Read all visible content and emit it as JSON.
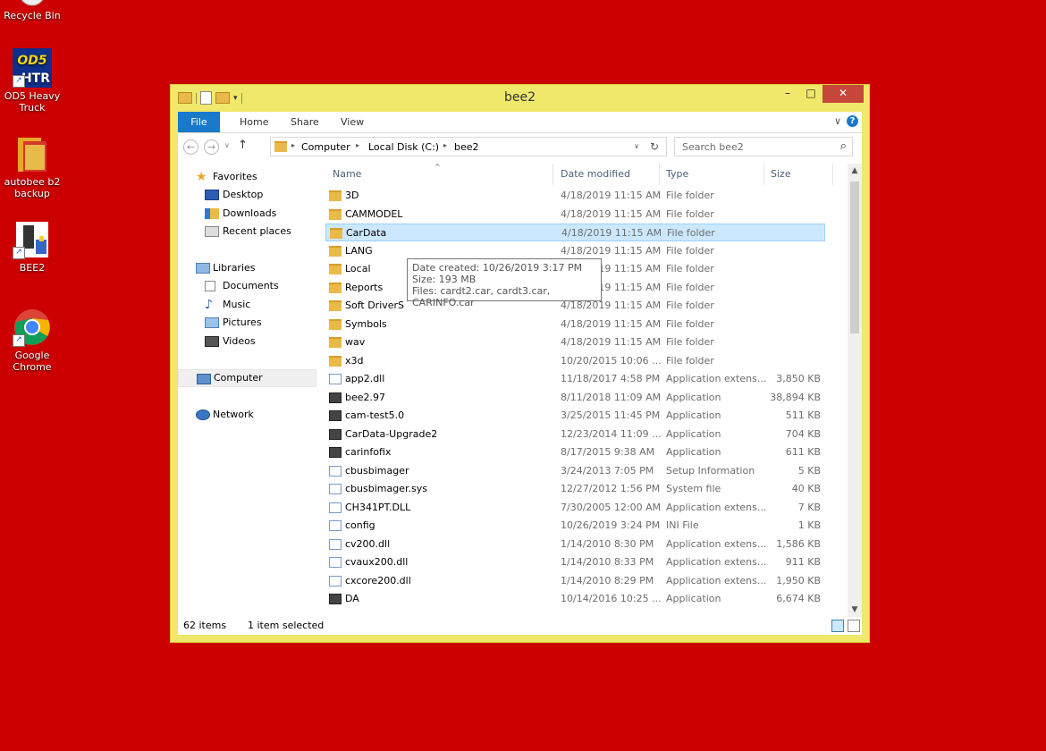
{
  "desktop": {
    "icons": [
      {
        "label": "Recycle Bin"
      },
      {
        "label": "OD5 Heavy Truck",
        "badge_top": "OD5",
        "badge_bottom": "HTR"
      },
      {
        "label": "autobee b2 backup"
      },
      {
        "label": "BEE2"
      },
      {
        "label": "Google Chrome"
      }
    ]
  },
  "window": {
    "title": "bee2",
    "controls": {
      "minimize": "–",
      "maximize": "□",
      "close": "✕"
    },
    "ribbon": {
      "tabs": [
        "File",
        "Home",
        "Share",
        "View"
      ],
      "expand_glyph": "∨",
      "help_glyph": "?"
    },
    "address": {
      "back_glyph": "←",
      "forward_glyph": "→",
      "recent_glyph": "∨",
      "up_glyph": "↑",
      "crumbs": [
        "Computer",
        "Local Disk (C:)",
        "bee2"
      ],
      "crumb_sep": "▸",
      "dropdown_glyph": "∨",
      "refresh_glyph": "↻"
    },
    "search": {
      "placeholder": "Search bee2",
      "icon_glyph": "⌕"
    },
    "nav": {
      "favorites": "Favorites",
      "favorites_items": [
        "Desktop",
        "Downloads",
        "Recent places"
      ],
      "libraries": "Libraries",
      "libraries_items": [
        "Documents",
        "Music",
        "Pictures",
        "Videos"
      ],
      "computer": "Computer",
      "network": "Network"
    },
    "columns": {
      "name": "Name",
      "date": "Date modified",
      "type": "Type",
      "size": "Size",
      "sort_glyph": "^"
    },
    "files": [
      {
        "name": "3D",
        "date": "4/18/2019 11:15 AM",
        "type": "File folder",
        "size": "",
        "kind": "folder"
      },
      {
        "name": "CAMMODEL",
        "date": "4/18/2019 11:15 AM",
        "type": "File folder",
        "size": "",
        "kind": "folder"
      },
      {
        "name": "CarData",
        "date": "4/18/2019 11:15 AM",
        "type": "File folder",
        "size": "",
        "kind": "folder",
        "selected": true
      },
      {
        "name": "LANG",
        "date": "4/18/2019 11:15 AM",
        "type": "File folder",
        "size": "",
        "kind": "folder"
      },
      {
        "name": "Local",
        "date": "4/18/2019 11:15 AM",
        "type": "File folder",
        "size": "",
        "kind": "folder"
      },
      {
        "name": "Reports",
        "date": "4/18/2019 11:15 AM",
        "type": "File folder",
        "size": "",
        "kind": "folder"
      },
      {
        "name": "Soft DriverS",
        "date": "4/18/2019 11:15 AM",
        "type": "File folder",
        "size": "",
        "kind": "folder"
      },
      {
        "name": "Symbols",
        "date": "4/18/2019 11:15 AM",
        "type": "File folder",
        "size": "",
        "kind": "folder"
      },
      {
        "name": "wav",
        "date": "4/18/2019 11:15 AM",
        "type": "File folder",
        "size": "",
        "kind": "folder"
      },
      {
        "name": "x3d",
        "date": "10/20/2015 10:06 ...",
        "type": "File folder",
        "size": "",
        "kind": "folder"
      },
      {
        "name": "app2.dll",
        "date": "11/18/2017 4:58 PM",
        "type": "Application extens...",
        "size": "3,850 KB",
        "kind": "file"
      },
      {
        "name": "bee2.97",
        "date": "8/11/2018 11:09 AM",
        "type": "Application",
        "size": "38,894 KB",
        "kind": "app"
      },
      {
        "name": "cam-test5.0",
        "date": "3/25/2015 11:45 PM",
        "type": "Application",
        "size": "511 KB",
        "kind": "app"
      },
      {
        "name": "CarData-Upgrade2",
        "date": "12/23/2014 11:09 ...",
        "type": "Application",
        "size": "704 KB",
        "kind": "app"
      },
      {
        "name": "carinfofix",
        "date": "8/17/2015 9:38 AM",
        "type": "Application",
        "size": "611 KB",
        "kind": "app"
      },
      {
        "name": "cbusbimager",
        "date": "3/24/2013 7:05 PM",
        "type": "Setup Information",
        "size": "5 KB",
        "kind": "file"
      },
      {
        "name": "cbusbimager.sys",
        "date": "12/27/2012 1:56 PM",
        "type": "System file",
        "size": "40 KB",
        "kind": "file"
      },
      {
        "name": "CH341PT.DLL",
        "date": "7/30/2005 12:00 AM",
        "type": "Application extens...",
        "size": "7 KB",
        "kind": "file"
      },
      {
        "name": "config",
        "date": "10/26/2019 3:24 PM",
        "type": "INI File",
        "size": "1 KB",
        "kind": "file"
      },
      {
        "name": "cv200.dll",
        "date": "1/14/2010 8:30 PM",
        "type": "Application extens...",
        "size": "1,586 KB",
        "kind": "file"
      },
      {
        "name": "cvaux200.dll",
        "date": "1/14/2010 8:33 PM",
        "type": "Application extens...",
        "size": "911 KB",
        "kind": "file"
      },
      {
        "name": "cxcore200.dll",
        "date": "1/14/2010 8:29 PM",
        "type": "Application extens...",
        "size": "1,950 KB",
        "kind": "file"
      },
      {
        "name": "DA",
        "date": "10/14/2016 10:25 ...",
        "type": "Application",
        "size": "6,674 KB",
        "kind": "app"
      }
    ],
    "tooltip": {
      "created": "Date created: 10/26/2019 3:17 PM",
      "size": "Size: 193 MB",
      "files": "Files: cardt2.car, cardt3.car, CARINFO.car"
    },
    "status": {
      "items": "62 items",
      "selected": "1 item selected"
    }
  },
  "colors": {
    "desktop": "#cc0000",
    "frame": "#f0e86a",
    "accent": "#1979ca",
    "selection": "#cce8ff",
    "close": "#c7473a"
  }
}
